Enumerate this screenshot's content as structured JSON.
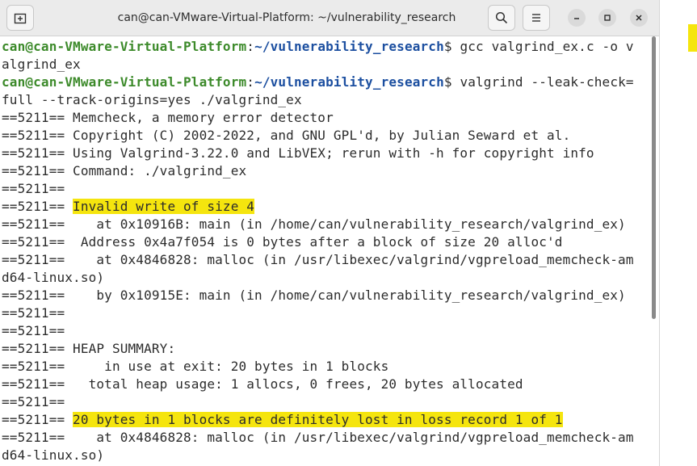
{
  "window": {
    "title": "can@can-VMware-Virtual-Platform: ~/vulnerability_research",
    "icons": {
      "new_tab": "new-tab-icon",
      "search": "search-icon",
      "menu": "hamburger-menu-icon",
      "minimize": "minimize-icon",
      "maximize": "maximize-icon",
      "close": "close-icon"
    }
  },
  "colors": {
    "prompt_user": "#3c8a2a",
    "prompt_path": "#1c4fa0",
    "highlight": "#f5e50e",
    "text": "#2c2c2c"
  },
  "terminal": {
    "prompt1": {
      "user": "can@can-VMware-Virtual-Platform",
      "sep": ":",
      "path": "~/vulnerability_research",
      "cmd": "$ gcc valgrind_ex.c -o v"
    },
    "line2": "algrind_ex",
    "prompt2": {
      "user": "can@can-VMware-Virtual-Platform",
      "sep": ":",
      "path": "~/vulnerability_research",
      "cmd": "$ valgrind --leak-check="
    },
    "line4": "full --track-origins=yes ./valgrind_ex",
    "line5": "==5211== Memcheck, a memory error detector",
    "line6": "==5211== Copyright (C) 2002-2022, and GNU GPL'd, by Julian Seward et al.",
    "line7": "==5211== Using Valgrind-3.22.0 and LibVEX; rerun with -h for copyright info",
    "line8": "==5211== Command: ./valgrind_ex",
    "line9": "==5211==",
    "line10_prefix": "==5211== ",
    "line10_hl": "Invalid write of size 4",
    "line11": "==5211==    at 0x10916B: main (in /home/can/vulnerability_research/valgrind_ex)",
    "line12": "==5211==  Address 0x4a7f054 is 0 bytes after a block of size 20 alloc'd",
    "line13": "==5211==    at 0x4846828: malloc (in /usr/libexec/valgrind/vgpreload_memcheck-am",
    "line14": "d64-linux.so)",
    "line15": "==5211==    by 0x10915E: main (in /home/can/vulnerability_research/valgrind_ex)",
    "line16": "==5211==",
    "line17": "==5211==",
    "line18": "==5211== HEAP SUMMARY:",
    "line19": "==5211==     in use at exit: 20 bytes in 1 blocks",
    "line20": "==5211==   total heap usage: 1 allocs, 0 frees, 20 bytes allocated",
    "line21": "==5211==",
    "line22_prefix": "==5211== ",
    "line22_hl": "20 bytes in 1 blocks are definitely lost in loss record 1 of 1",
    "line23": "==5211==    at 0x4846828: malloc (in /usr/libexec/valgrind/vgpreload_memcheck-am",
    "line24": "d64-linux.so)"
  }
}
